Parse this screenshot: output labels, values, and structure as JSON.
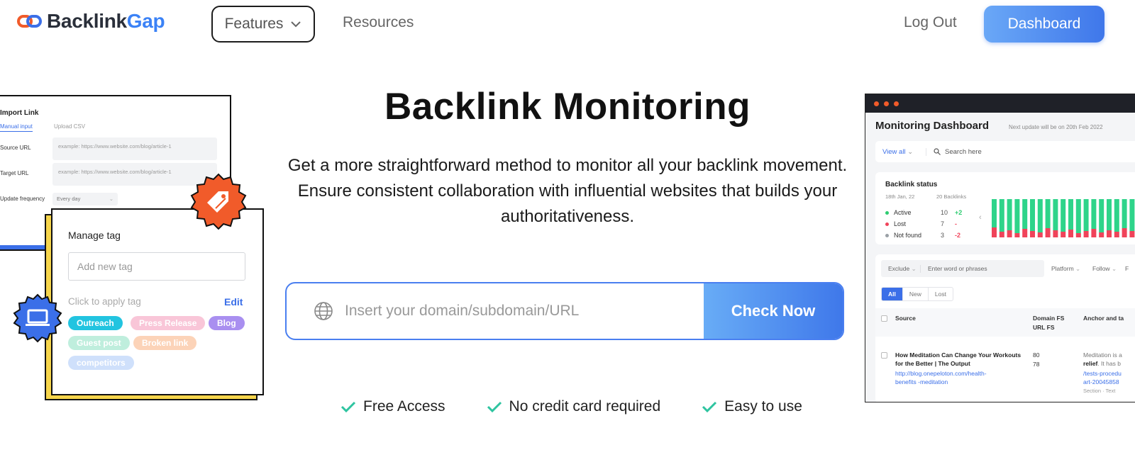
{
  "nav": {
    "logo_part1": "Backlink",
    "logo_part2": "Gap",
    "features_label": "Features",
    "resources_label": "Resources",
    "logout_label": "Log Out",
    "dashboard_label": "Dashboard"
  },
  "hero": {
    "title": "Backlink Monitoring",
    "desc_line1": "Get a more straightforward method to monitor all your backlink movement.",
    "desc_line2": "Ensure consistent collaboration with influential websites that builds your authoritativeness.",
    "search_placeholder": "Insert your domain/subdomain/URL",
    "check_button": "Check Now",
    "features": [
      "Free Access",
      "No credit card required",
      "Easy to use"
    ]
  },
  "import_card": {
    "title": "Import Link",
    "tab_manual": "Manual input",
    "tab_csv": "Upload CSV",
    "source_label": "Source URL",
    "source_placeholder": "example: https://www.website.com/blog/article-1",
    "target_label": "Target URL",
    "target_placeholder": "example: https://www.website.com/blog/article-1",
    "freq_label": "Update frequency",
    "freq_value": "Every day"
  },
  "tag_card": {
    "title": "Manage tag",
    "input_placeholder": "Add new tag",
    "hint": "Click to apply tag",
    "edit": "Edit",
    "chips": [
      {
        "label": "Outreach",
        "color": "#22c4e0"
      },
      {
        "label": "Press Release",
        "color": "#f9c6d8"
      },
      {
        "label": "Blog",
        "color": "#a98ff0"
      },
      {
        "label": "Guest post",
        "color": "#bfeedd"
      },
      {
        "label": "Broken link",
        "color": "#fcd3b8"
      },
      {
        "label": "competitors",
        "color": "#cfe0fb"
      }
    ]
  },
  "dashboard": {
    "title": "Monitoring Dashboard",
    "subtitle": "Next update will be on 20th Feb 2022",
    "view_all": "View all",
    "search_placeholder": "Search here",
    "status": {
      "title": "Backlink status",
      "date": "18th Jan, 22",
      "count": "20 Backlinks",
      "rows": [
        {
          "label": "Active",
          "num": "10",
          "delta": "+2",
          "color": "#2ecc71",
          "delta_color": "#2ecc71"
        },
        {
          "label": "Lost",
          "num": "7",
          "delta": "-",
          "color": "#f0435a",
          "delta_color": "#f0435a"
        },
        {
          "label": "Not found",
          "num": "3",
          "delta": "-2",
          "color": "#9aa0a6",
          "delta_color": "#f0435a"
        }
      ]
    },
    "filter": {
      "exclude": "Exclude",
      "exclude_placeholder": "Enter word or phrases",
      "platform": "Platform",
      "follow": "Follow",
      "f": "F",
      "tabs": [
        "All",
        "New",
        "Lost"
      ],
      "col_source": "Source",
      "col_domain": "Domain FS",
      "col_url": "URL FS",
      "col_anchor": "Anchor and ta",
      "row_title": "How Meditation Can Change Your Workouts for the Better | The Output",
      "row_url": "http://blog.onepeloton.com/health-benefits -meditation",
      "row_domain_fs": "80",
      "row_url_fs": "78",
      "row_anchor_1": "Meditation is a",
      "row_anchor_2": "relief",
      "row_anchor_3": ". It has b",
      "row_url2_1": "/tests-procedu",
      "row_url2_2": "art-20045858",
      "row_section": "Section · Text"
    }
  }
}
